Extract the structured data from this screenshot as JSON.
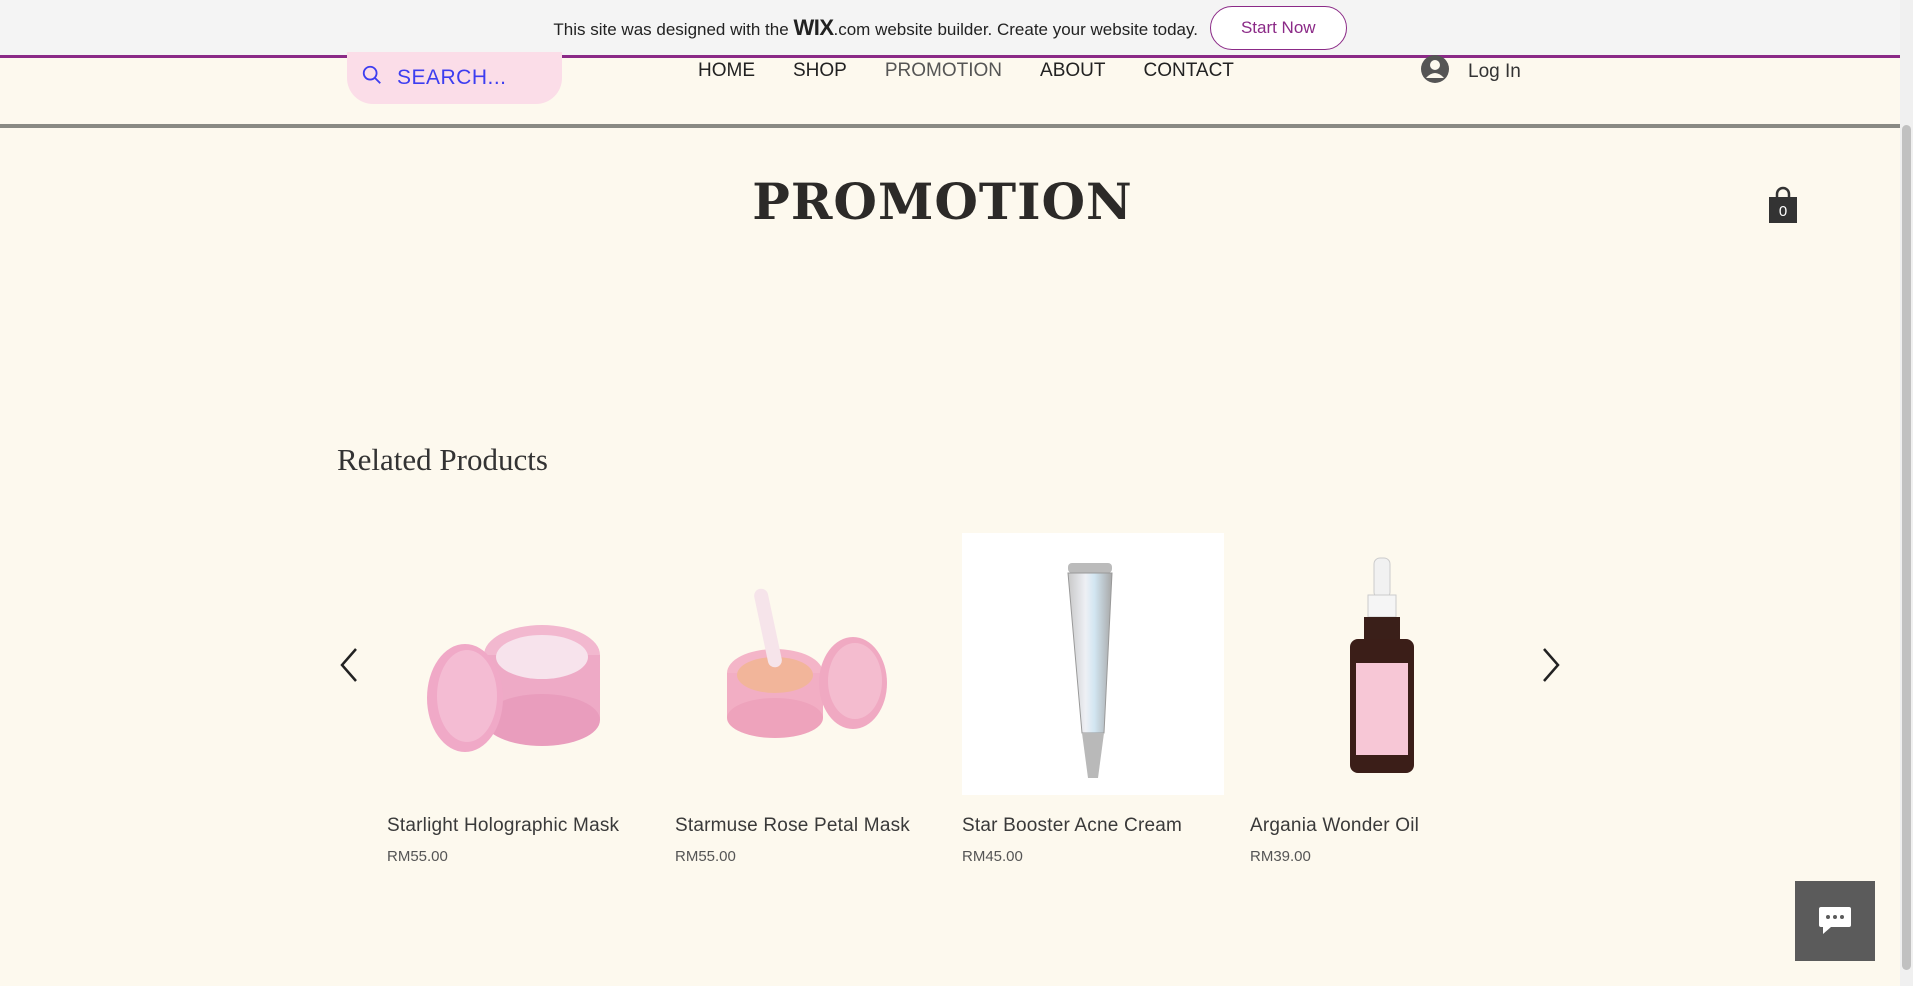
{
  "banner": {
    "text_before": "This site was designed with the",
    "logo": "WIX",
    "logo_suffix": ".com",
    "text_after": "website builder. Create your website today.",
    "cta": "Start Now"
  },
  "search": {
    "placeholder": "SEARCH..."
  },
  "nav": {
    "items": [
      "HOME",
      "SHOP",
      "PROMOTION",
      "ABOUT",
      "CONTACT"
    ]
  },
  "login": {
    "label": "Log In"
  },
  "page": {
    "title": "PROMOTION"
  },
  "cart": {
    "count": "0"
  },
  "related": {
    "heading": "Related Products",
    "products": [
      {
        "name": "Starlight Holographic Mask",
        "price": "RM55.00"
      },
      {
        "name": "Starmuse Rose Petal Mask",
        "price": "RM55.00"
      },
      {
        "name": "Star Booster Acne Cream",
        "price": "RM45.00"
      },
      {
        "name": "Argania Wonder Oil",
        "price": "RM39.00"
      }
    ]
  },
  "colors": {
    "accent": "#8b2a87",
    "background": "#fdf9ee",
    "search_bg": "#fbdde8",
    "search_text": "#3d3df0"
  },
  "icons": [
    "search-icon",
    "user-icon",
    "cart-icon",
    "chevron-left-icon",
    "chevron-right-icon",
    "chat-icon"
  ]
}
